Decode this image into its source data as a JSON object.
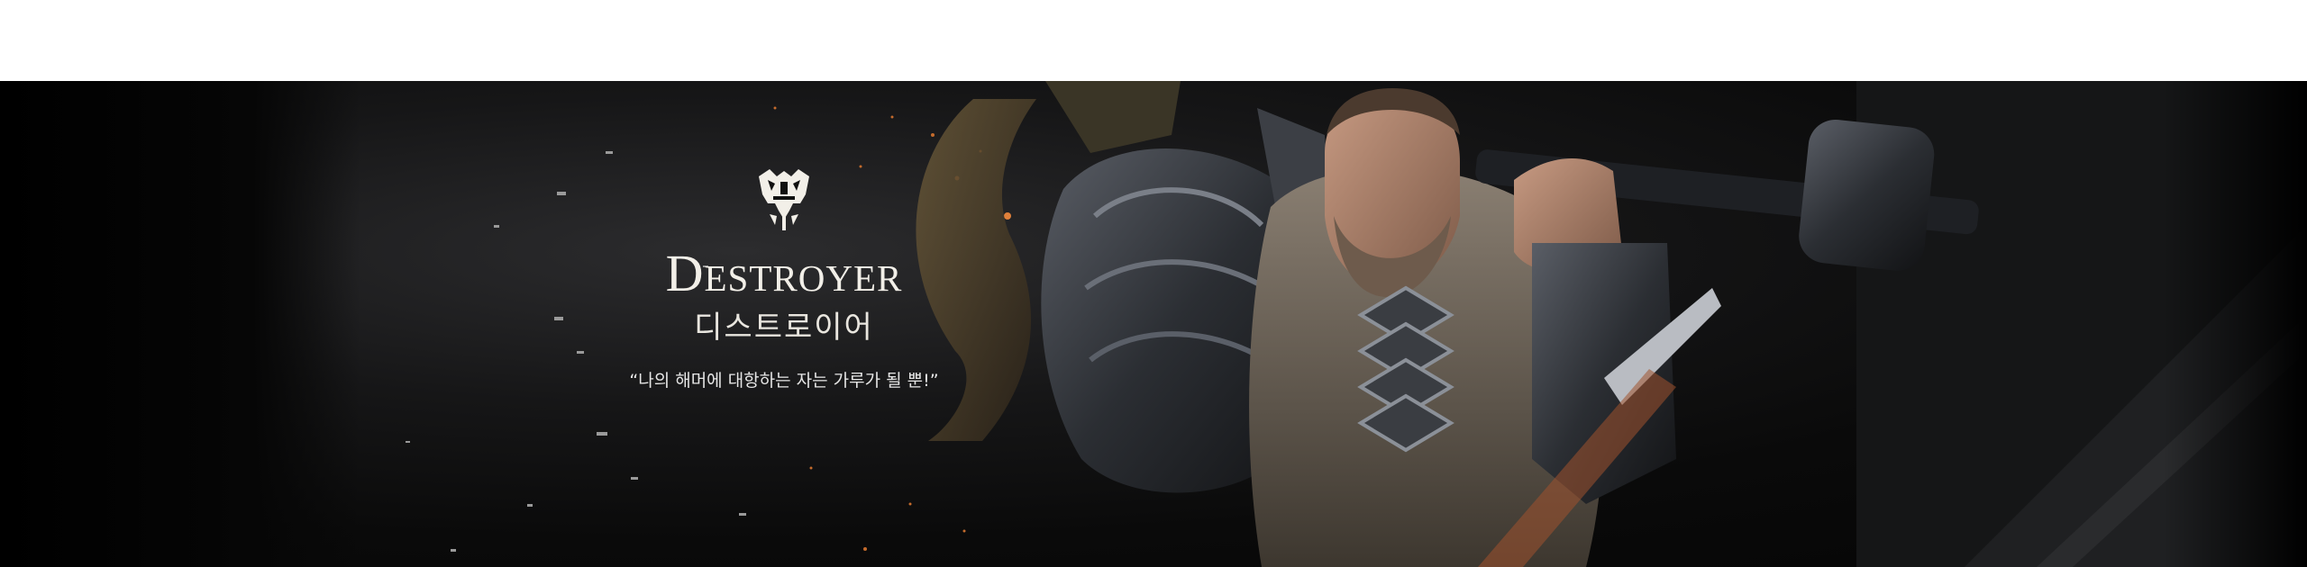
{
  "banner": {
    "class_name": "Destroyer",
    "class_name_kr": "디스트로이어",
    "quote": "“나의 해머에 대항하는 자는 가루가 될 뿐!”",
    "emblem_icon": "destroyer-emblem-icon",
    "accent_color": "#f2efe8",
    "background_color": "#0a0a0a"
  }
}
